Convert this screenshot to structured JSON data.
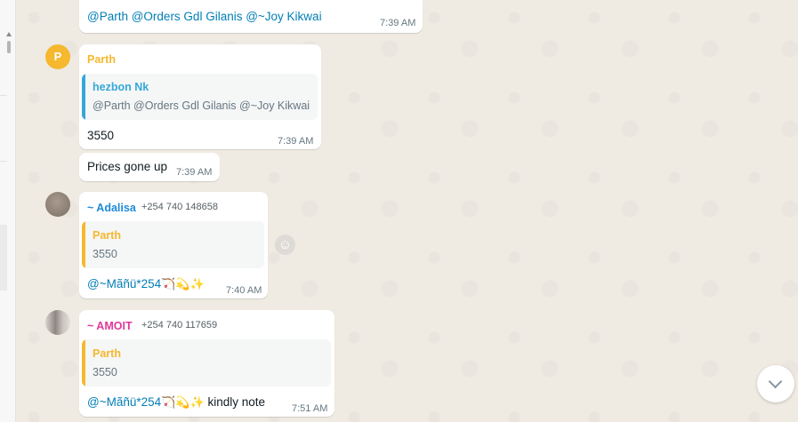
{
  "colors": {
    "chat_bg": "#efeae2",
    "bubble_bg": "#ffffff",
    "mention": "#027eb5",
    "parth": "#f5b82e",
    "hezbon": "#35a8d9",
    "adalisa": "#1f8ad9",
    "amoit": "#e0399a"
  },
  "icons": {
    "scroll_down": "chevron-down-icon",
    "react": "smiley-icon"
  },
  "messages": {
    "m0": {
      "text_mentions": "@Parth @Orders Gdl Gilanis @~Joy Kikwai",
      "time": "7:39 AM"
    },
    "m1": {
      "avatar_letter": "P",
      "sender": "Parth",
      "quote_name": "hezbon Nk",
      "quote_text": "@Parth @Orders Gdl Gilanis @~Joy Kikwai",
      "text": "3550",
      "time": "7:39 AM"
    },
    "m2": {
      "text": "Prices gone up",
      "time": "7:39 AM"
    },
    "m3": {
      "sender": "~ Adalisa",
      "phone": "+254 740 148658",
      "quote_name": "Parth",
      "quote_text": "3550",
      "text_mention": "@~Mãñü*254",
      "emoji": "🏹💫✨",
      "time": "7:40 AM"
    },
    "m4": {
      "sender": "~ AMOIT",
      "phone": "+254 740 117659",
      "quote_name": "Parth",
      "quote_text": "3550",
      "text_mention": "@~Mãñü*254",
      "emoji": "🏹💫✨",
      "text_after": " kindly note",
      "time": "7:51 AM"
    }
  }
}
